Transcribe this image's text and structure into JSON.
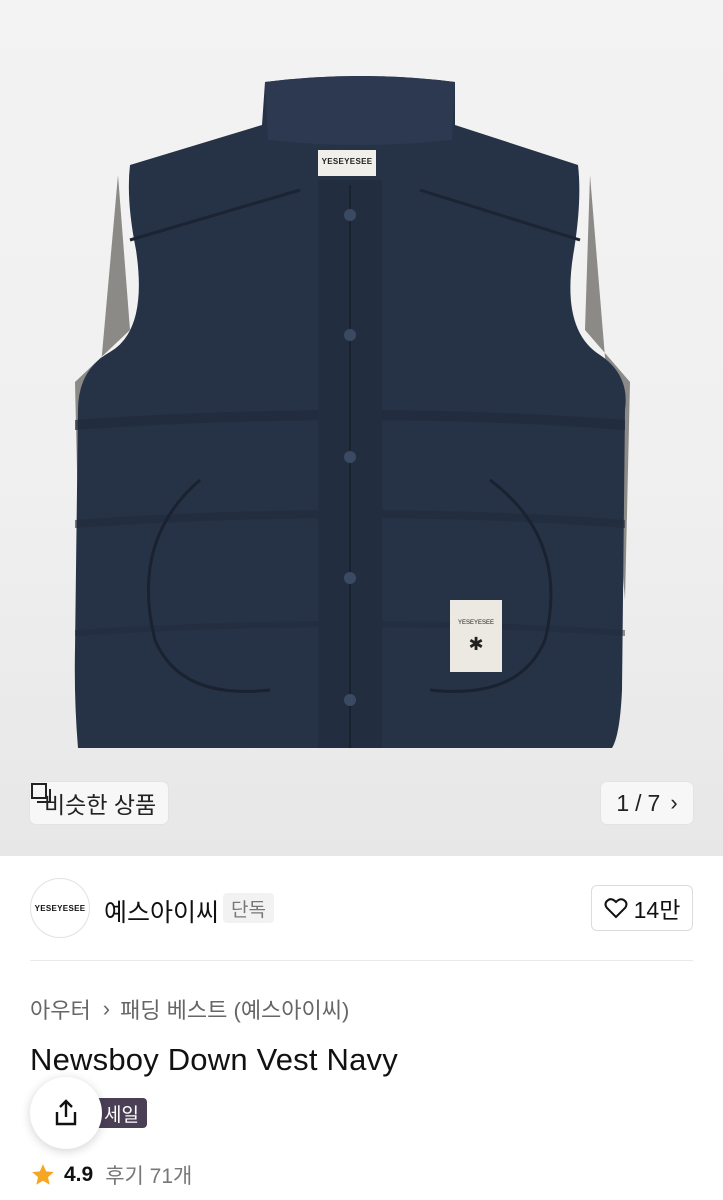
{
  "hero": {
    "image_label": "YESEYESEE",
    "similar_button": {
      "icon": "similar-products-icon",
      "label": "비슷한 상품"
    },
    "pager": {
      "current": "1",
      "separator": "/",
      "total": "7",
      "icon": "chevron-right-icon"
    }
  },
  "brand": {
    "logo_text": "YESEYESEE",
    "name": "예스아이씨",
    "badge": "단독",
    "like_icon": "heart-icon",
    "like_count": "14만"
  },
  "breadcrumb": {
    "level1": "아우터",
    "level2": "패딩 베스트 (예스아이씨)",
    "arrow_icon": "chevron-right-icon"
  },
  "product": {
    "title": "Newsboy Down Vest Navy",
    "sale_badge": "세일",
    "share_icon": "share-icon"
  },
  "rating": {
    "icon": "star-icon",
    "score": "4.9",
    "reviews_label": "후기 71개"
  },
  "colors": {
    "star": "#f5a623",
    "sale_badge": "#4b3f55",
    "vest_navy": "#263246"
  }
}
